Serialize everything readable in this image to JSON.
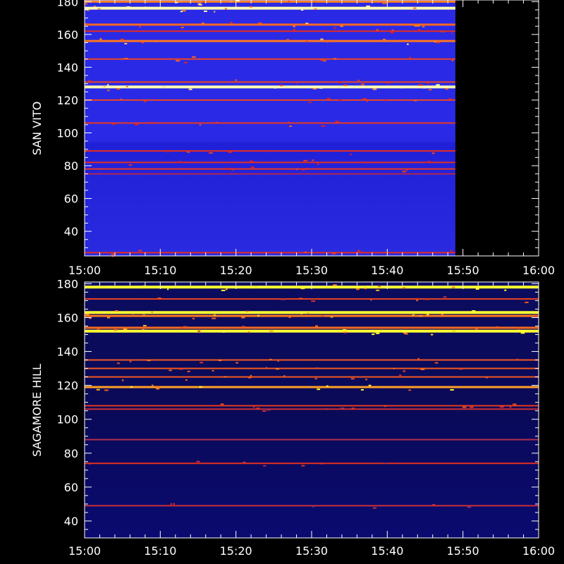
{
  "chart_data": [
    {
      "type": "heatmap",
      "title": "",
      "ylabel": "SAN VITO",
      "xlabel": "",
      "x_ticks": [
        "15:00",
        "15:10",
        "15:20",
        "15:30",
        "15:40",
        "15:50",
        "16:00"
      ],
      "x_range": [
        "15:00",
        "16:00"
      ],
      "data_end": "15:49",
      "y_ticks": [
        40,
        60,
        80,
        100,
        120,
        140,
        160,
        180
      ],
      "ylim": [
        25,
        181
      ],
      "background_color": "#2a2ae6",
      "colors": {
        "low": "#1a1ad8",
        "mid": "#6a2a9a",
        "hot": "#e02020",
        "max": "#ffffb0"
      },
      "bands": [
        {
          "freq": 27,
          "intensity": 0.45
        },
        {
          "freq": 75,
          "intensity": 0.25
        },
        {
          "freq": 78,
          "intensity": 0.5
        },
        {
          "freq": 82,
          "intensity": 0.45
        },
        {
          "freq": 89,
          "intensity": 0.45
        },
        {
          "freq": 106,
          "intensity": 0.5
        },
        {
          "freq": 120,
          "intensity": 0.55
        },
        {
          "freq": 128,
          "intensity": 1.0
        },
        {
          "freq": 131,
          "intensity": 0.55
        },
        {
          "freq": 145,
          "intensity": 0.55
        },
        {
          "freq": 156,
          "intensity": 0.75
        },
        {
          "freq": 162,
          "intensity": 0.45
        },
        {
          "freq": 166,
          "intensity": 0.7
        },
        {
          "freq": 176,
          "intensity": 1.0
        },
        {
          "freq": 180,
          "intensity": 0.8
        }
      ]
    },
    {
      "type": "heatmap",
      "title": "",
      "ylabel": "SAGAMORE HILL",
      "xlabel": "",
      "x_ticks": [
        "15:00",
        "15:10",
        "15:20",
        "15:30",
        "15:40",
        "15:50",
        "16:00"
      ],
      "x_range": [
        "15:00",
        "16:00"
      ],
      "data_end": "16:00",
      "y_ticks": [
        40,
        60,
        80,
        100,
        120,
        140,
        160,
        180
      ],
      "ylim": [
        30,
        181
      ],
      "background_color": "#0a0a5a",
      "colors": {
        "low": "#0a0a5a",
        "mid": "#2a2ad0",
        "hot": "#e03020",
        "max": "#ffff30"
      },
      "bands": [
        {
          "freq": 49,
          "intensity": 0.35
        },
        {
          "freq": 74,
          "intensity": 0.4
        },
        {
          "freq": 88,
          "intensity": 0.3
        },
        {
          "freq": 106,
          "intensity": 0.35
        },
        {
          "freq": 108,
          "intensity": 0.45
        },
        {
          "freq": 119,
          "intensity": 0.85
        },
        {
          "freq": 125,
          "intensity": 0.6
        },
        {
          "freq": 130,
          "intensity": 0.6
        },
        {
          "freq": 135,
          "intensity": 0.6
        },
        {
          "freq": 152,
          "intensity": 1.0
        },
        {
          "freq": 154,
          "intensity": 0.7
        },
        {
          "freq": 161,
          "intensity": 0.75
        },
        {
          "freq": 163,
          "intensity": 1.0
        },
        {
          "freq": 171,
          "intensity": 0.5
        },
        {
          "freq": 178,
          "intensity": 1.0
        }
      ]
    }
  ]
}
